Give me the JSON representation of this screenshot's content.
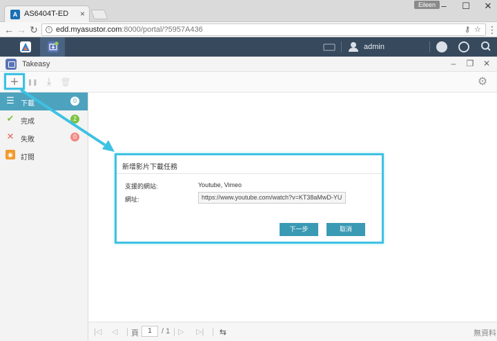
{
  "browser": {
    "tab_title": "AS6404T-ED",
    "tab_favicon_text": "A",
    "tab_close": "×",
    "user_badge": "Eileen",
    "win_minimize": "–",
    "win_maximize": "☐",
    "win_close": "✕",
    "back_glyph": "←",
    "forward_glyph": "→",
    "reload_glyph": "↻",
    "site_info_glyph": "i",
    "url_host": "edd.myasustor.com",
    "url_rest": ":8000/portal/?5957A436",
    "key_glyph": "⚷",
    "star_glyph": "☆",
    "menu_glyph": "⋮"
  },
  "topbar": {
    "username": "admin",
    "icons": [
      "app-central-icon",
      "takeasy-icon",
      "keyboard-icon",
      "user-icon",
      "notification-icon",
      "power-icon",
      "search-icon"
    ]
  },
  "window": {
    "title": "Takeasy",
    "min": "–",
    "restore": "❐",
    "close": "✕"
  },
  "toolbar": {
    "add": "+",
    "pause": "❚❚",
    "download": "⤓",
    "delete": "🗑",
    "settings": "⚙"
  },
  "sidebar": {
    "items": [
      {
        "label": "下載",
        "count": "0",
        "icon": "list-icon",
        "glyph": "☰",
        "color": "#ffffff",
        "badge": "#ffffff"
      },
      {
        "label": "完成",
        "count": "2",
        "icon": "check-icon",
        "glyph": "✔",
        "color": "#7cc242",
        "badge": "#7cc242"
      },
      {
        "label": "失敗",
        "count": "0",
        "icon": "cross-icon",
        "glyph": "✕",
        "color": "#e8625f",
        "badge": "#f08a85"
      },
      {
        "label": "訂閱",
        "count": "",
        "icon": "rss-icon",
        "glyph": "◉",
        "color": "#f29a2e",
        "badge": ""
      }
    ]
  },
  "pager": {
    "page_label": "頁",
    "page_value": "1",
    "total": "/ 1",
    "first": "|◁",
    "prev": "◁",
    "next": "▷",
    "last": "▷|",
    "refresh": "⇆",
    "no_data": "無資料"
  },
  "dialog": {
    "title": "新增影片下載任務",
    "supported_label": "支援的網站:",
    "supported_value": "Youtube, Vimeo",
    "url_label": "網址:",
    "url_value": "https://www.youtube.com/watch?v=KT38aMwD-YU",
    "next_button": "下一步",
    "cancel_button": "取消"
  },
  "colors": {
    "accent": "#3ec1e3",
    "primary_button": "#3a9ab3",
    "sidebar_active": "#4da3be",
    "adm_bar": "#37495c"
  }
}
